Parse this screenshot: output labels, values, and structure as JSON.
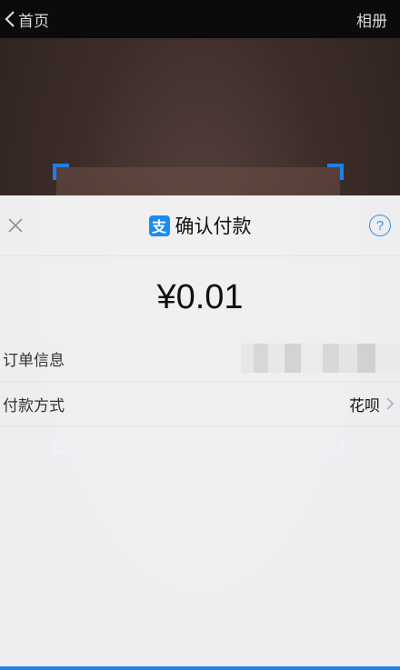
{
  "nav": {
    "back_label": "首页",
    "album_label": "相册"
  },
  "sheet": {
    "logo_text": "支",
    "title": "确认付款",
    "help_label": "?",
    "amount": "¥0.01",
    "rows": [
      {
        "label": "订单信息",
        "value": ""
      },
      {
        "label": "付款方式",
        "value": "花呗"
      }
    ]
  },
  "colors": {
    "accent": "#1a8ef0",
    "nav_bg": "#0b0b0b"
  },
  "icons": [
    "back-chevron-icon",
    "close-icon",
    "help-icon",
    "alipay-logo",
    "chevron-right-icon"
  ]
}
